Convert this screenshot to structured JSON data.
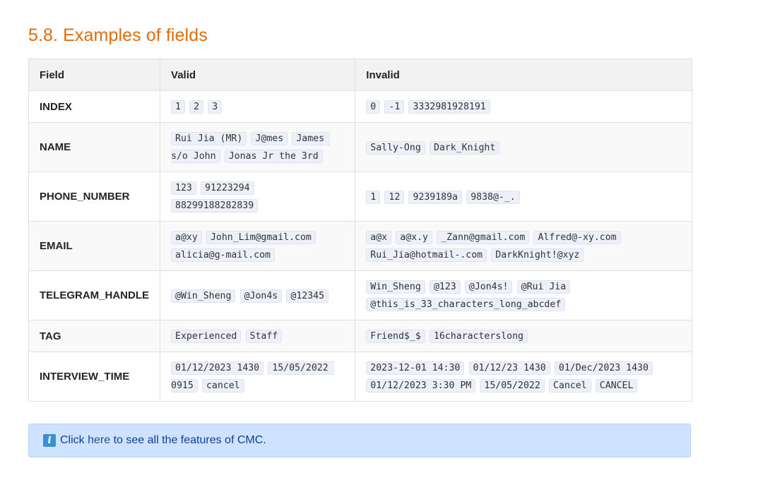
{
  "section": {
    "title": "5.8. Examples of fields"
  },
  "table": {
    "headers": [
      "Field",
      "Valid",
      "Invalid"
    ],
    "rows": [
      {
        "field": "INDEX",
        "valid": [
          "1",
          "2",
          "3"
        ],
        "invalid": [
          "0",
          "-1",
          "3332981928191"
        ]
      },
      {
        "field": "NAME",
        "valid": [
          "Rui Jia (MR)",
          "J@mes",
          "James s/o John",
          "Jonas Jr the 3rd"
        ],
        "invalid": [
          "Sally-Ong",
          "Dark_Knight"
        ]
      },
      {
        "field": "PHONE_NUMBER",
        "valid": [
          "123",
          "91223294",
          "88299188282839"
        ],
        "invalid": [
          "1",
          "12",
          "9239189a",
          "9838@-_."
        ]
      },
      {
        "field": "EMAIL",
        "valid": [
          "a@xy",
          "John_Lim@gmail.com",
          "alicia@g-mail.com"
        ],
        "invalid": [
          "a@x",
          "a@x.y",
          "_Zann@gmail.com",
          "Alfred@-xy.com",
          "Rui_Jia@hotmail-.com",
          "DarkKnight!@xyz"
        ]
      },
      {
        "field": "TELEGRAM_HANDLE",
        "valid": [
          "@Win_Sheng",
          "@Jon4s",
          "@12345"
        ],
        "invalid": [
          "Win_Sheng",
          "@123",
          "@Jon4s!",
          "@Rui Jia",
          "@this_is_33_characters_long_abcdef"
        ]
      },
      {
        "field": "TAG",
        "valid": [
          "Experienced",
          "Staff"
        ],
        "invalid": [
          "Friend$_$",
          "16characterslong"
        ]
      },
      {
        "field": "INTERVIEW_TIME",
        "valid": [
          "01/12/2023 1430",
          "15/05/2022 0915",
          "cancel"
        ],
        "invalid": [
          "2023-12-01 14:30",
          "01/12/23 1430",
          "01/Dec/2023 1430",
          "01/12/2023 3:30 PM",
          "15/05/2022",
          "Cancel",
          "CANCEL"
        ]
      }
    ]
  },
  "callout": {
    "icon": "info-icon",
    "prefix": "Click",
    "link_label": "here",
    "suffix": "to see all the features of CMC."
  },
  "colors": {
    "title": "#e46c0a",
    "callout_bg": "#cfe2ff",
    "code_bg": "#eef0f9"
  }
}
